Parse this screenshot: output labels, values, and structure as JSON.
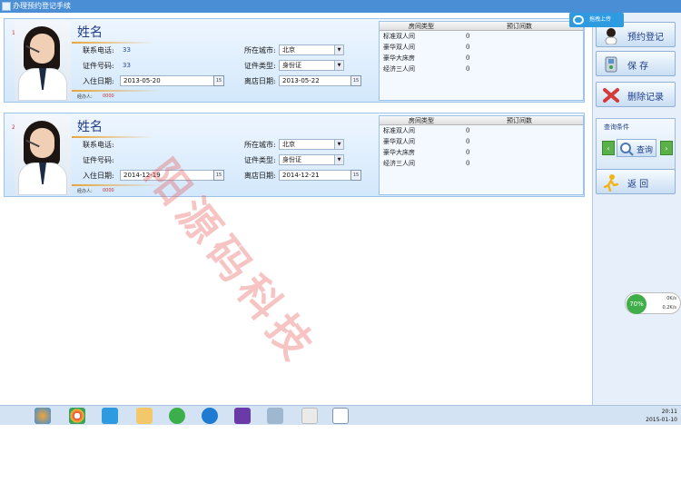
{
  "window": {
    "title": "办理预约登记手续"
  },
  "cards": [
    {
      "number": "1",
      "name": "姓名",
      "labels": {
        "phone": "联系电话:",
        "city": "所在城市:",
        "id_no": "证件号码:",
        "id_type": "证件类型:",
        "checkin": "入住日期:",
        "checkout": "离店日期:",
        "agent": "经办人:"
      },
      "phone": "33",
      "id_no": "33",
      "city": "北京",
      "id_type": "身份证",
      "checkin": "2013-05-20",
      "checkout": "2013-05-22",
      "agent": "0000"
    },
    {
      "number": "2",
      "name": "姓名",
      "labels": {
        "phone": "联系电话:",
        "city": "所在城市:",
        "id_no": "证件号码:",
        "id_type": "证件类型:",
        "checkin": "入住日期:",
        "checkout": "离店日期:",
        "agent": "经办人:"
      },
      "phone": "",
      "id_no": "",
      "city": "北京",
      "id_type": "身份证",
      "checkin": "2014-12-19",
      "checkout": "2014-12-21",
      "agent": "0000"
    }
  ],
  "rooms": {
    "headers": {
      "type": "房间类型",
      "count": "预订间数"
    },
    "rows": [
      {
        "type": "标准双人间",
        "count": "0"
      },
      {
        "type": "豪华双人间",
        "count": "0"
      },
      {
        "type": "豪华大床房",
        "count": "0"
      },
      {
        "type": "经济三人间",
        "count": "0"
      }
    ]
  },
  "calendar_label": "15",
  "sidebar": {
    "register": "预约登记",
    "save": "保 存",
    "delete": "删除记录",
    "query_title": "查询条件",
    "query": "查询",
    "back": "返 回"
  },
  "overlay": {
    "upload": "拖拽上传",
    "speed_pct": "70%",
    "speed_up": "0K/s",
    "speed_down": "0.2K/s"
  },
  "watermark": "阳源码科技",
  "taskbar": {
    "time": "20:11",
    "date": "2015-01-10"
  },
  "colors": {
    "accent": "#4a8ed6",
    "card_bg": "#d3e8fb",
    "value_blue": "#2b4aa8"
  }
}
